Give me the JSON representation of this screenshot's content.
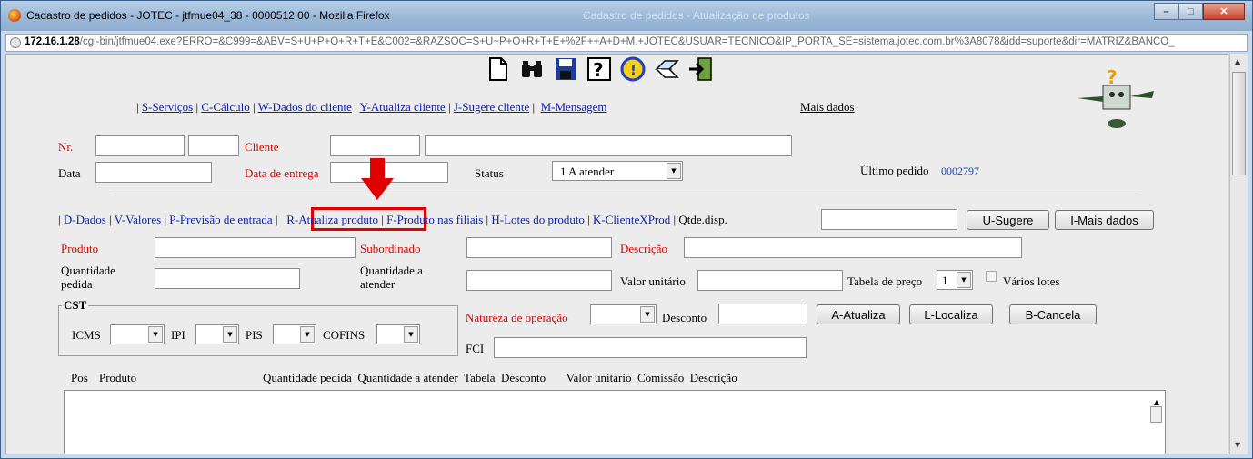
{
  "window": {
    "title": "Cadastro de pedidos - JOTEC - jtfmue04_38 - 0000512.00 - Mozilla Firefox",
    "faded_title": "Cadastro de pedidos - Atualização de produtos"
  },
  "url": {
    "host": "172.16.1.28",
    "path": "/cgi-bin/jtfmue04.exe?ERRO=&C999=&ABV=S+U+P+O+R+T+E&C002=&RAZSOC=S+U+P+O+R+T+E+%2F++A+D+M.+JOTEC&USUAR=TECNICO&IP_PORTA_SE=sistema.jotec.com.br%3A8078&idd=suporte&dir=MATRIZ&BANCO_"
  },
  "toolbar": {
    "icons": [
      "new-document-icon",
      "binoculars-search-icon",
      "save-disk-icon",
      "help-icon",
      "info-icon",
      "notes-icon",
      "exit-door-icon"
    ]
  },
  "top_links": {
    "prefix": "|",
    "items": [
      "S-Serviços",
      "C-Cálculo",
      "W-Dados do cliente",
      "Y-Atualiza cliente",
      "J-Sugere cliente",
      "M-Mensagem"
    ],
    "more": "Mais dados"
  },
  "header": {
    "nr_label": "Nr.",
    "cliente_label": "Cliente",
    "data_label": "Data",
    "data_entrega_label": "Data de entrega",
    "status_label": "Status",
    "status_value": "1 A atender",
    "ultimo_pedido_label": "Último pedido",
    "ultimo_pedido_value": "0002797"
  },
  "item_links": {
    "items": [
      "D-Dados",
      "V-Valores",
      "P-Previsão de entrada",
      "R-Atualiza produto",
      "F-Produto nas filiais",
      "H-Lotes do produto",
      "K-ClienteXProd"
    ],
    "qtde_label": "Qtde.disp.",
    "sugere_button": "U-Sugere",
    "mais_button": "I-Mais dados"
  },
  "item_form": {
    "produto": "Produto",
    "subordinado": "Subordinado",
    "descricao": "Descrição",
    "qtd_pedida_1": "Quantidade",
    "qtd_pedida_2": "pedida",
    "qtd_atender_1": "Quantidade a",
    "qtd_atender_2": "atender",
    "valor_unitario": "Valor unitário",
    "tabela_preco": "Tabela de preço",
    "tabela_value": "1",
    "varios_lotes": "Vários lotes",
    "cst_legend": "CST",
    "icms": "ICMS",
    "ipi": "IPI",
    "pis": "PIS",
    "cofins": "COFINS",
    "natureza": "Natureza de operação",
    "desconto": "Desconto",
    "fci": "FCI",
    "atualiza_button": "A-Atualiza",
    "localiza_button": "L-Localiza",
    "cancela_button": "B-Cancela"
  },
  "list_header": {
    "pos": "Pos",
    "produto": "Produto",
    "rest": "Quantidade pedida  Quantidade a atender  Tabela  Desconto       Valor unitário  Comissão  Descrição"
  }
}
